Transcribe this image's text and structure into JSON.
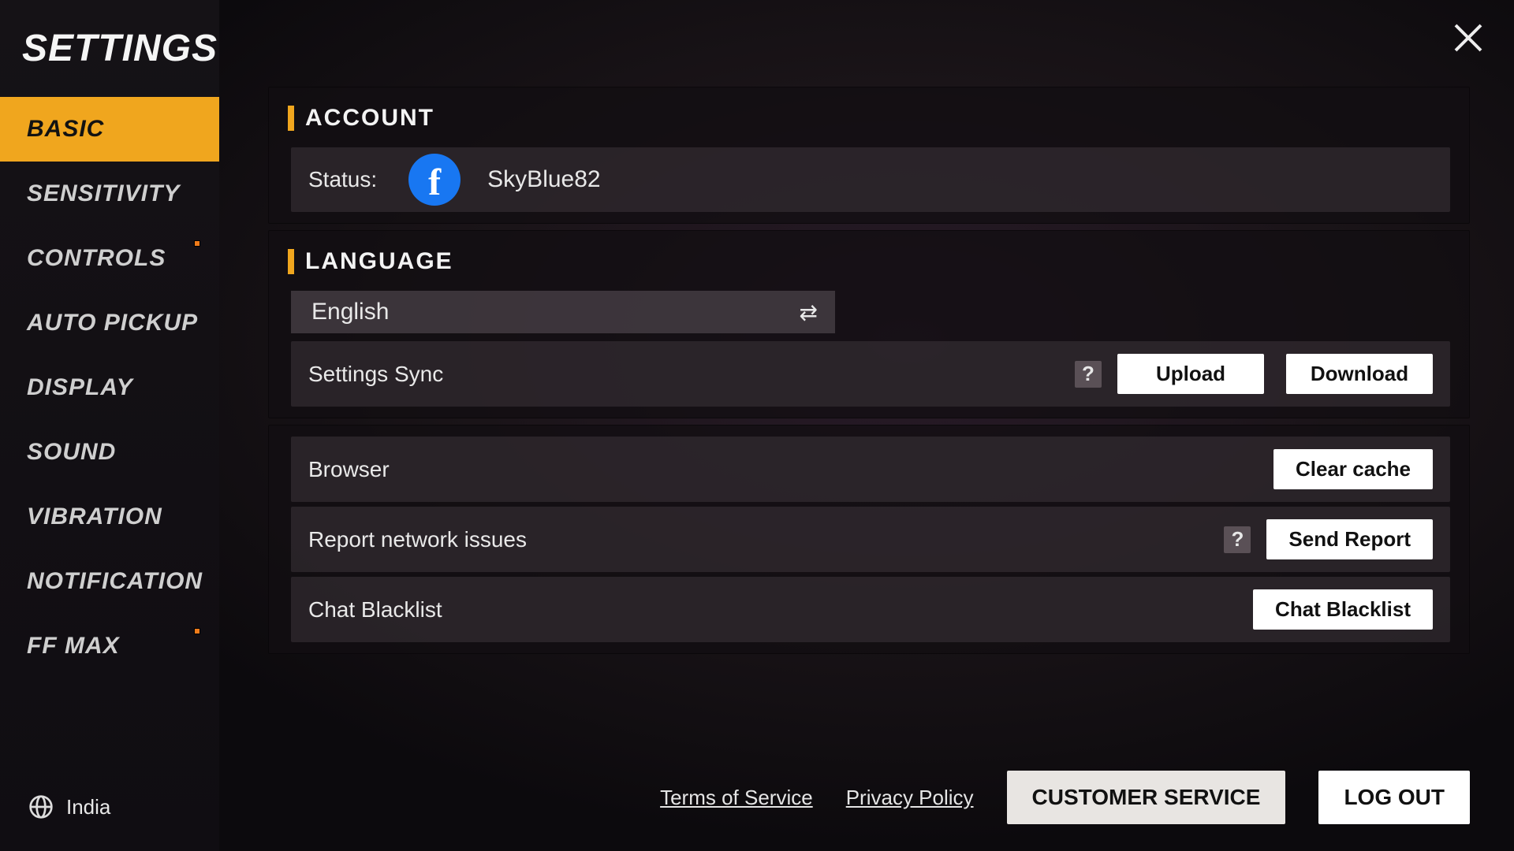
{
  "sidebar": {
    "title": "SETTINGS",
    "items": [
      {
        "label": "BASIC",
        "active": true
      },
      {
        "label": "SENSITIVITY"
      },
      {
        "label": "CONTROLS",
        "dot": true
      },
      {
        "label": "AUTO PICKUP"
      },
      {
        "label": "DISPLAY"
      },
      {
        "label": "SOUND"
      },
      {
        "label": "VIBRATION"
      },
      {
        "label": "NOTIFICATION"
      },
      {
        "label": "FF MAX",
        "dot": true
      }
    ],
    "region": "India"
  },
  "account": {
    "header": "ACCOUNT",
    "status_label": "Status:",
    "username": "SkyBlue82",
    "provider": "facebook"
  },
  "language": {
    "header": "LANGUAGE",
    "selected": "English"
  },
  "settings_sync": {
    "label": "Settings Sync",
    "upload": "Upload",
    "download": "Download"
  },
  "misc": {
    "browser_label": "Browser",
    "clear_cache": "Clear cache",
    "report_label": "Report network issues",
    "send_report": "Send Report",
    "chat_blacklist_label": "Chat Blacklist",
    "chat_blacklist_btn": "Chat Blacklist"
  },
  "footer": {
    "tos": "Terms of Service",
    "privacy": "Privacy Policy",
    "customer_service": "CUSTOMER SERVICE",
    "logout": "LOG OUT"
  }
}
